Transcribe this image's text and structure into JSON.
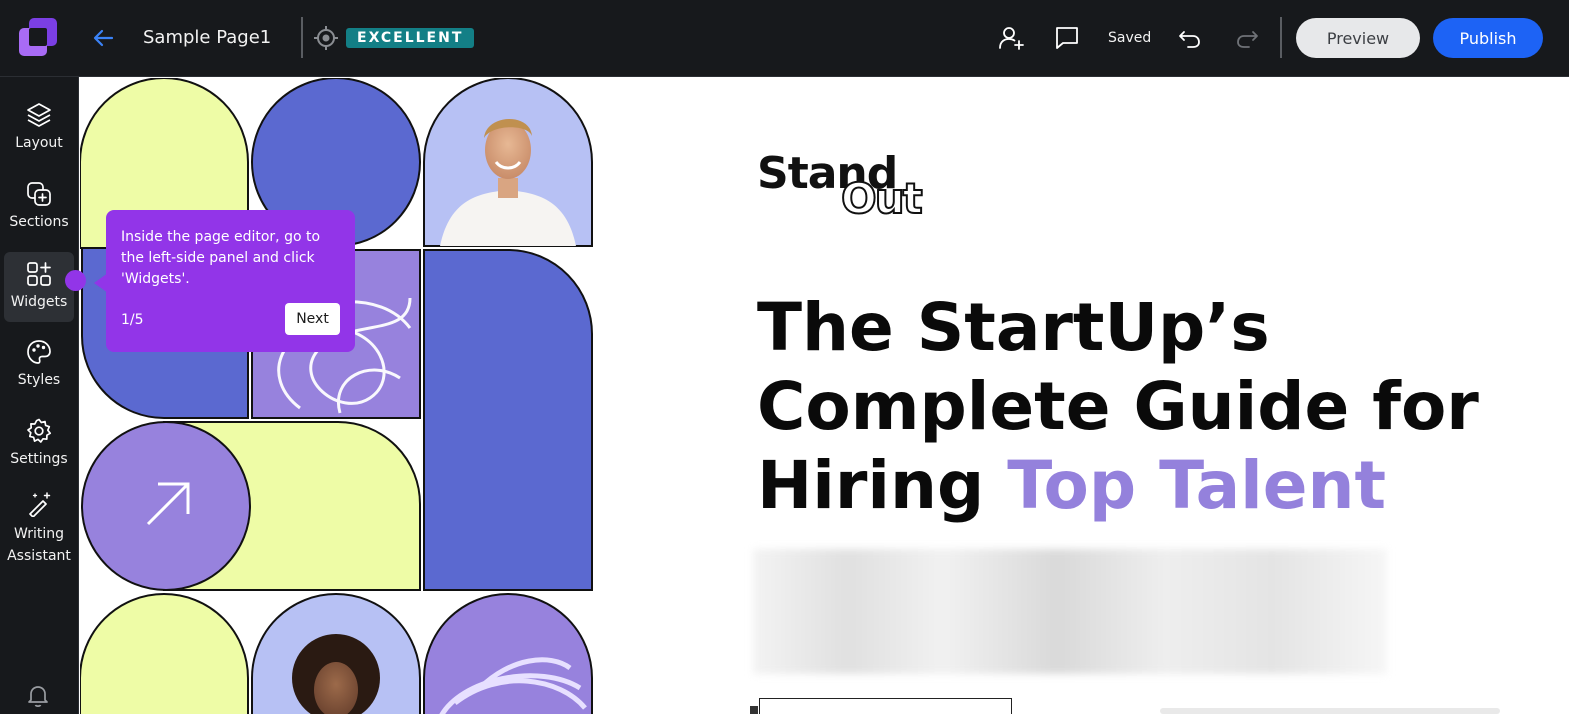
{
  "topbar": {
    "page_name": "Sample Page1",
    "badge": "EXCELLENT",
    "status": "Saved",
    "preview_label": "Preview",
    "publish_label": "Publish",
    "icons": [
      "logo-icon",
      "back-arrow-icon",
      "target-icon",
      "add-user-icon",
      "comment-icon",
      "undo-icon",
      "redo-icon"
    ]
  },
  "sidebar": {
    "items": [
      {
        "label": "Layout",
        "icon": "layers-icon"
      },
      {
        "label": "Sections",
        "icon": "add-section-icon"
      },
      {
        "label": "Widgets",
        "icon": "widgets-icon"
      },
      {
        "label": "Styles",
        "icon": "palette-icon"
      },
      {
        "label": "Settings",
        "icon": "gear-icon"
      },
      {
        "label": "Writing Assistant",
        "icon": "magic-pen-icon"
      }
    ],
    "active": "Widgets",
    "bottom_icon": "bell-icon"
  },
  "tooltip": {
    "text": "Inside the page editor, go to the left-side panel and click 'Widgets'.",
    "step": "1/5",
    "next_label": "Next"
  },
  "content": {
    "brand_line1": "Stand",
    "brand_line2": "Out",
    "headline_line1": "The StartUp’s",
    "headline_line2": "Complete Guide for",
    "headline_line3_plain": "Hiring ",
    "headline_line3_accent": "Top Talent"
  },
  "colors": {
    "topbar_bg": "#17191c",
    "badge_bg": "#137f86",
    "publish_blue": "#1d63f5",
    "tooltip_purple": "#9235e8",
    "accent_lavender": "#9481dc",
    "shape_lime": "#eefca6",
    "shape_blue": "#5b69d0",
    "shape_lavender": "#b7c1f4",
    "shape_purple": "#9782dd"
  }
}
